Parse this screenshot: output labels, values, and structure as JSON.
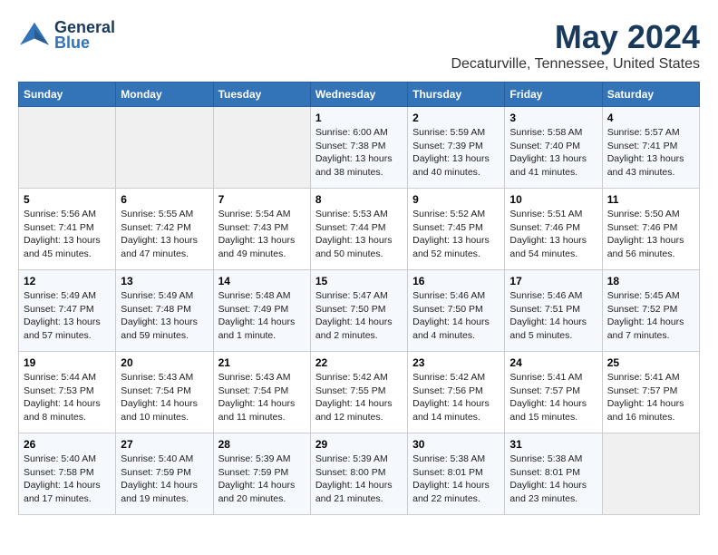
{
  "header": {
    "logo_line1": "General",
    "logo_line2": "Blue",
    "month": "May 2024",
    "location": "Decaturville, Tennessee, United States"
  },
  "days_of_week": [
    "Sunday",
    "Monday",
    "Tuesday",
    "Wednesday",
    "Thursday",
    "Friday",
    "Saturday"
  ],
  "weeks": [
    [
      {
        "day": "",
        "info": ""
      },
      {
        "day": "",
        "info": ""
      },
      {
        "day": "",
        "info": ""
      },
      {
        "day": "1",
        "info": "Sunrise: 6:00 AM\nSunset: 7:38 PM\nDaylight: 13 hours\nand 38 minutes."
      },
      {
        "day": "2",
        "info": "Sunrise: 5:59 AM\nSunset: 7:39 PM\nDaylight: 13 hours\nand 40 minutes."
      },
      {
        "day": "3",
        "info": "Sunrise: 5:58 AM\nSunset: 7:40 PM\nDaylight: 13 hours\nand 41 minutes."
      },
      {
        "day": "4",
        "info": "Sunrise: 5:57 AM\nSunset: 7:41 PM\nDaylight: 13 hours\nand 43 minutes."
      }
    ],
    [
      {
        "day": "5",
        "info": "Sunrise: 5:56 AM\nSunset: 7:41 PM\nDaylight: 13 hours\nand 45 minutes."
      },
      {
        "day": "6",
        "info": "Sunrise: 5:55 AM\nSunset: 7:42 PM\nDaylight: 13 hours\nand 47 minutes."
      },
      {
        "day": "7",
        "info": "Sunrise: 5:54 AM\nSunset: 7:43 PM\nDaylight: 13 hours\nand 49 minutes."
      },
      {
        "day": "8",
        "info": "Sunrise: 5:53 AM\nSunset: 7:44 PM\nDaylight: 13 hours\nand 50 minutes."
      },
      {
        "day": "9",
        "info": "Sunrise: 5:52 AM\nSunset: 7:45 PM\nDaylight: 13 hours\nand 52 minutes."
      },
      {
        "day": "10",
        "info": "Sunrise: 5:51 AM\nSunset: 7:46 PM\nDaylight: 13 hours\nand 54 minutes."
      },
      {
        "day": "11",
        "info": "Sunrise: 5:50 AM\nSunset: 7:46 PM\nDaylight: 13 hours\nand 56 minutes."
      }
    ],
    [
      {
        "day": "12",
        "info": "Sunrise: 5:49 AM\nSunset: 7:47 PM\nDaylight: 13 hours\nand 57 minutes."
      },
      {
        "day": "13",
        "info": "Sunrise: 5:49 AM\nSunset: 7:48 PM\nDaylight: 13 hours\nand 59 minutes."
      },
      {
        "day": "14",
        "info": "Sunrise: 5:48 AM\nSunset: 7:49 PM\nDaylight: 14 hours\nand 1 minute."
      },
      {
        "day": "15",
        "info": "Sunrise: 5:47 AM\nSunset: 7:50 PM\nDaylight: 14 hours\nand 2 minutes."
      },
      {
        "day": "16",
        "info": "Sunrise: 5:46 AM\nSunset: 7:50 PM\nDaylight: 14 hours\nand 4 minutes."
      },
      {
        "day": "17",
        "info": "Sunrise: 5:46 AM\nSunset: 7:51 PM\nDaylight: 14 hours\nand 5 minutes."
      },
      {
        "day": "18",
        "info": "Sunrise: 5:45 AM\nSunset: 7:52 PM\nDaylight: 14 hours\nand 7 minutes."
      }
    ],
    [
      {
        "day": "19",
        "info": "Sunrise: 5:44 AM\nSunset: 7:53 PM\nDaylight: 14 hours\nand 8 minutes."
      },
      {
        "day": "20",
        "info": "Sunrise: 5:43 AM\nSunset: 7:54 PM\nDaylight: 14 hours\nand 10 minutes."
      },
      {
        "day": "21",
        "info": "Sunrise: 5:43 AM\nSunset: 7:54 PM\nDaylight: 14 hours\nand 11 minutes."
      },
      {
        "day": "22",
        "info": "Sunrise: 5:42 AM\nSunset: 7:55 PM\nDaylight: 14 hours\nand 12 minutes."
      },
      {
        "day": "23",
        "info": "Sunrise: 5:42 AM\nSunset: 7:56 PM\nDaylight: 14 hours\nand 14 minutes."
      },
      {
        "day": "24",
        "info": "Sunrise: 5:41 AM\nSunset: 7:57 PM\nDaylight: 14 hours\nand 15 minutes."
      },
      {
        "day": "25",
        "info": "Sunrise: 5:41 AM\nSunset: 7:57 PM\nDaylight: 14 hours\nand 16 minutes."
      }
    ],
    [
      {
        "day": "26",
        "info": "Sunrise: 5:40 AM\nSunset: 7:58 PM\nDaylight: 14 hours\nand 17 minutes."
      },
      {
        "day": "27",
        "info": "Sunrise: 5:40 AM\nSunset: 7:59 PM\nDaylight: 14 hours\nand 19 minutes."
      },
      {
        "day": "28",
        "info": "Sunrise: 5:39 AM\nSunset: 7:59 PM\nDaylight: 14 hours\nand 20 minutes."
      },
      {
        "day": "29",
        "info": "Sunrise: 5:39 AM\nSunset: 8:00 PM\nDaylight: 14 hours\nand 21 minutes."
      },
      {
        "day": "30",
        "info": "Sunrise: 5:38 AM\nSunset: 8:01 PM\nDaylight: 14 hours\nand 22 minutes."
      },
      {
        "day": "31",
        "info": "Sunrise: 5:38 AM\nSunset: 8:01 PM\nDaylight: 14 hours\nand 23 minutes."
      },
      {
        "day": "",
        "info": ""
      }
    ]
  ]
}
